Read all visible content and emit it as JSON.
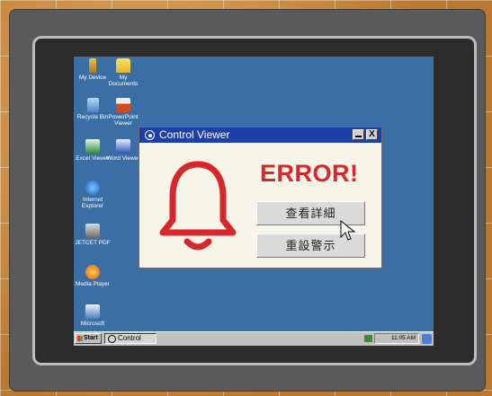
{
  "desktop": {
    "icons": [
      {
        "name": "my-device-icon",
        "label": "My Device"
      },
      {
        "name": "my-documents-icon",
        "label": "My Documents"
      },
      {
        "name": "recycle-bin-icon",
        "label": "Recycle Bin"
      },
      {
        "name": "powerpoint-viewer-icon",
        "label": "PowerPoint Viewer"
      },
      {
        "name": "excel-viewer-icon",
        "label": "Excel Viewer"
      },
      {
        "name": "word-viewer-icon",
        "label": "Word Viewer"
      },
      {
        "name": "internet-explorer-icon",
        "label": "Internet Explorer"
      },
      {
        "name": "jetcet-pdf-icon",
        "label": "JETCET PDF"
      },
      {
        "name": "media-player-icon",
        "label": "Media Player"
      },
      {
        "name": "microsoft-icon",
        "label": "Microsoft"
      }
    ]
  },
  "dialog": {
    "title": "Control Viewer",
    "error_text": "ERROR!",
    "button_details": "查看詳細",
    "button_reset": "重設警示",
    "close_glyph": "X"
  },
  "taskbar": {
    "start_label": "Start",
    "task_item": "Control",
    "clock": "11:05 AM"
  },
  "colors": {
    "desktop": "#3a6ea5",
    "titlebar": "#1d3fa8",
    "error_red": "#d9262c",
    "dialog_bg": "#f7f4e8"
  }
}
